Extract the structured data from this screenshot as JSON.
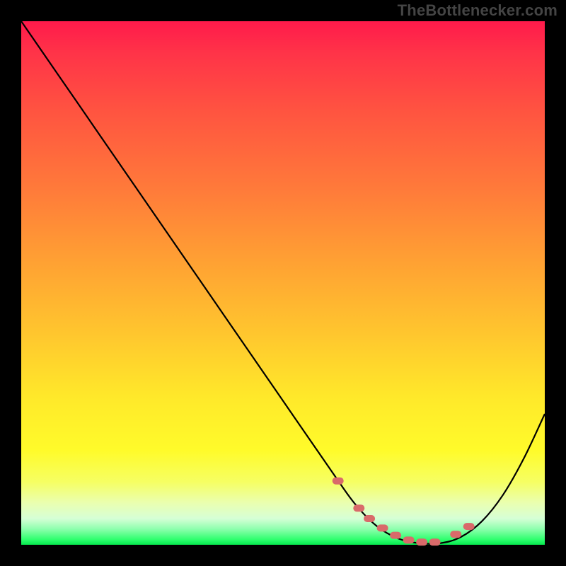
{
  "attribution": "TheBottlenecker.com",
  "colors": {
    "background": "#000000",
    "gradient_top": "#ff1a4b",
    "gradient_bottom": "#06e84e",
    "curve": "#000000",
    "marker": "#d96a6a"
  },
  "chart_data": {
    "type": "line",
    "title": "",
    "xlabel": "",
    "ylabel": "",
    "xlim": [
      0,
      100
    ],
    "ylim": [
      0,
      100
    ],
    "series": [
      {
        "name": "bottleneck-curve",
        "x": [
          0,
          10,
          20,
          30,
          40,
          50,
          60,
          64,
          68,
          72,
          76,
          80,
          84,
          88,
          92,
          96,
          100
        ],
        "values": [
          100,
          85.5,
          71,
          56.5,
          42,
          27.5,
          13,
          7.5,
          3.5,
          1.2,
          0.3,
          0.3,
          1.5,
          4.5,
          9.5,
          16.5,
          25
        ]
      }
    ],
    "markers": {
      "name": "highlight-dots",
      "x": [
        60.5,
        64.5,
        66.5,
        69,
        71.5,
        74,
        76.5,
        79,
        83,
        85.5
      ],
      "values": [
        12.2,
        7.0,
        5.0,
        3.2,
        1.8,
        0.9,
        0.5,
        0.5,
        2.0,
        3.5
      ],
      "shape": "rounded-rect"
    },
    "annotations": []
  }
}
